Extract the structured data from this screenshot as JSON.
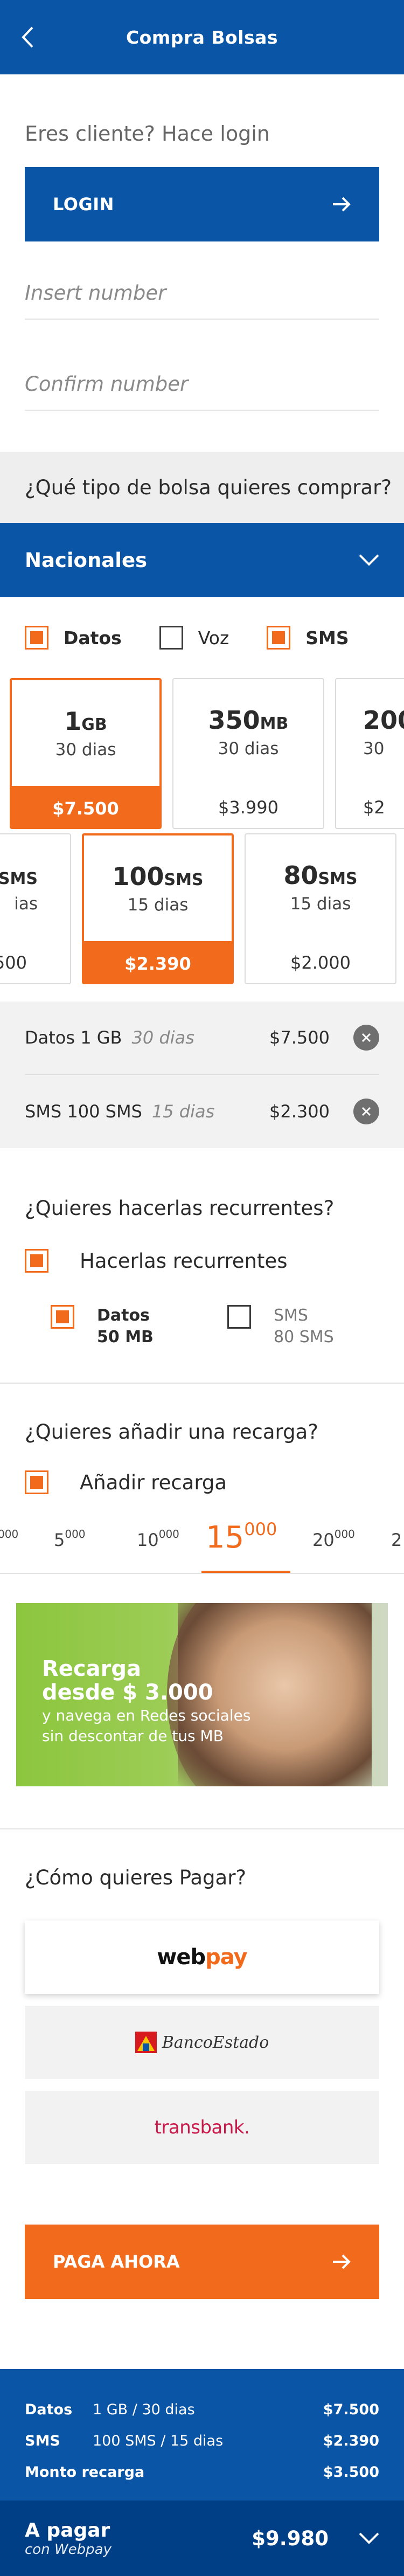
{
  "header": {
    "title": "Compra Bolsas",
    "back_icon": "chevron-left-icon"
  },
  "login": {
    "hint": "Eres cliente? Hace login",
    "button_label": "LOGIN",
    "insert_placeholder": "Insert number",
    "confirm_placeholder": "Confirm number"
  },
  "bag_question": "¿Qué tipo de bolsa quieres comprar?",
  "region": {
    "label": "Nacionales"
  },
  "types": [
    {
      "label": "Datos",
      "checked": true
    },
    {
      "label": "Voz",
      "checked": false
    },
    {
      "label": "SMS",
      "checked": true
    }
  ],
  "data_cards": [
    {
      "amount": "1",
      "unit": "GB",
      "days": "30 dias",
      "price": "$7.500",
      "selected": true
    },
    {
      "amount": "350",
      "unit": "MB",
      "days": "30 dias",
      "price": "$3.990",
      "selected": false
    },
    {
      "amount": "200",
      "unit": "",
      "days": "30",
      "price": "$2",
      "selected": false
    }
  ],
  "sms_cards": [
    {
      "amount": "",
      "unit": "SMS",
      "days": "ias",
      "price": "500",
      "selected": false
    },
    {
      "amount": "100",
      "unit": "SMS",
      "days": "15 dias",
      "price": "$2.390",
      "selected": true
    },
    {
      "amount": "80",
      "unit": "SMS",
      "days": "15 dias",
      "price": "$2.000",
      "selected": false
    }
  ],
  "selected_items": [
    {
      "name": "Datos 1 GB",
      "duration": "30 dias",
      "price": "$7.500"
    },
    {
      "name": "SMS 100 SMS",
      "duration": "15 dias",
      "price": "$2.300"
    }
  ],
  "recurring": {
    "question": "¿Quieres hacerlas recurrentes?",
    "check_label": "Hacerlas recurrentes",
    "options": [
      {
        "line1": "Datos",
        "line2": "50 MB",
        "checked": true
      },
      {
        "line1": "SMS",
        "line2": "80 SMS",
        "checked": false
      }
    ]
  },
  "recharge": {
    "question": "¿Quieres añadir una recarga?",
    "check_label": "Añadir recarga",
    "amounts": [
      {
        "main": "",
        "sup": "000"
      },
      {
        "main": "5",
        "sup": "000"
      },
      {
        "main": "10",
        "sup": "000"
      },
      {
        "main": "15",
        "sup": "000"
      },
      {
        "main": "20",
        "sup": "000"
      },
      {
        "main": "2",
        "sup": ""
      }
    ],
    "selected_index": 3
  },
  "promo": {
    "line1": "Recarga",
    "line2": "desde $ 3.000",
    "line3": "y navega en Redes sociales",
    "line4": "sin descontar de tus MB"
  },
  "payment": {
    "question": "¿Cómo quieres Pagar?",
    "webpay_a": "web",
    "webpay_b": "pay",
    "bancoestado": "BancoEstado",
    "transbank": "transbank.",
    "pay_button": "PAGA AHORA"
  },
  "footer": {
    "lines": [
      {
        "k": "Datos",
        "v": "1 GB / 30 dias",
        "p": "$7.500"
      },
      {
        "k": "SMS",
        "v": "100 SMS / 15 dias",
        "p": "$2.390"
      },
      {
        "k": "Monto recarga",
        "v": "",
        "p": "$3.500"
      }
    ],
    "total_label": "A pagar",
    "total_sub": "con Webpay",
    "total_value": "$9.980"
  },
  "colors": {
    "brand_blue": "#0a55a5",
    "brand_orange": "#f26b1d",
    "dark_blue": "#003e86"
  }
}
